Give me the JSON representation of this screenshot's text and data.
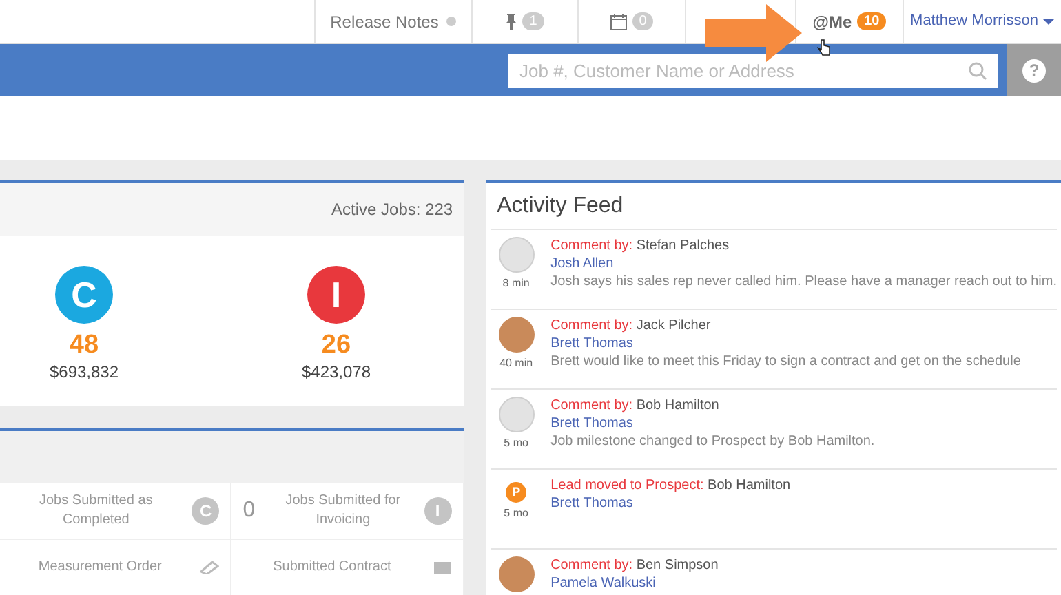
{
  "top_nav": {
    "release_notes": "Release Notes",
    "pins": "1",
    "calendar": "0",
    "mentions": {
      "label": "@Me",
      "count": "10"
    },
    "user": "Matthew Morrisson"
  },
  "search": {
    "placeholder": "Job #, Customer Name or Address"
  },
  "help": "?",
  "jobs_panel": {
    "active_jobs": "Active Jobs: 223",
    "stats": [
      {
        "letter": "C",
        "color": "#1ba8e0",
        "count": "48",
        "amount": "$693,832"
      },
      {
        "letter": "I",
        "color": "#e8383d",
        "count": "26",
        "amount": "$423,078"
      }
    ]
  },
  "submissions": {
    "cells": [
      {
        "label": "Jobs Submitted as Completed",
        "letter": "C",
        "kind": "letter"
      },
      {
        "count": "0",
        "label": "Jobs Submitted for Invoicing",
        "letter": "I",
        "kind": "letter"
      },
      {
        "label": "Measurement Order",
        "kind": "ruler"
      },
      {
        "label": "Submitted Contract",
        "kind": "document"
      }
    ]
  },
  "activity_feed": {
    "title": "Activity Feed",
    "items": [
      {
        "kind": "blank",
        "time": "8 min",
        "prefix": "Comment by:",
        "author": "Stefan Palches",
        "customer": "Josh Allen",
        "message": "Josh says his sales rep never called him. Please have a manager reach out to him."
      },
      {
        "kind": "photo",
        "time": "40 min",
        "prefix": "Comment by:",
        "author": "Jack Pilcher",
        "customer": "Brett Thomas",
        "message": "Brett would like to meet this Friday to sign a contract and get on the schedule"
      },
      {
        "kind": "blank",
        "time": "5 mo",
        "prefix": "Comment by:",
        "author": "Bob Hamilton",
        "customer": "Brett Thomas",
        "message": "Job milestone changed to Prospect by Bob Hamilton."
      },
      {
        "kind": "badge",
        "badge": "P",
        "time": "5 mo",
        "prefix": "Lead moved to Prospect:",
        "author": "Bob Hamilton",
        "customer": "Brett Thomas"
      },
      {
        "kind": "photo",
        "prefix": "Comment by:",
        "author": "Ben Simpson",
        "customer": "Pamela Walkuski"
      }
    ]
  }
}
